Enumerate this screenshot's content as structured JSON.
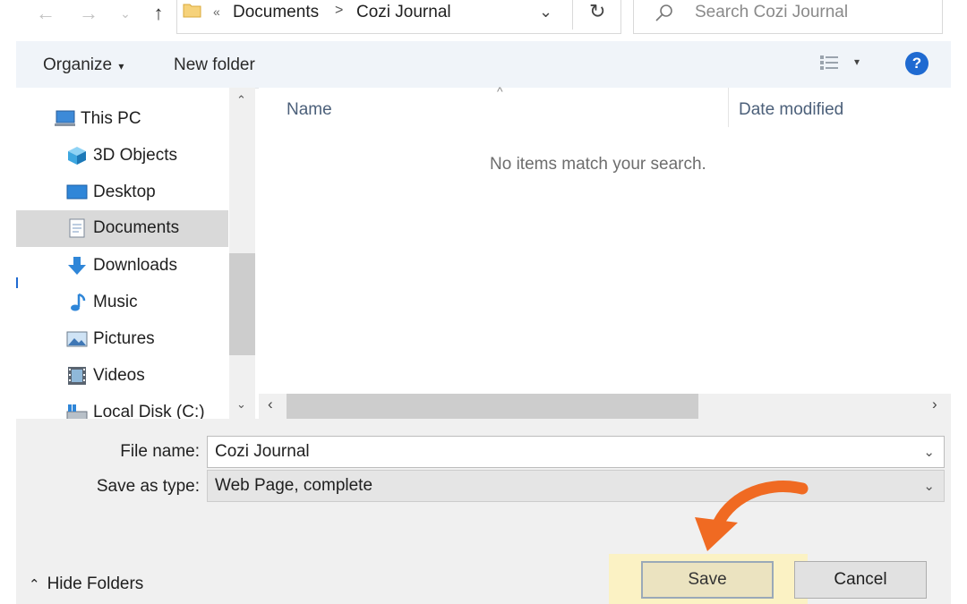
{
  "address": {
    "overflow": "«",
    "crumbs": [
      "Documents",
      "Cozi Journal"
    ],
    "separator": ">"
  },
  "search": {
    "placeholder": "Search Cozi Journal"
  },
  "toolbar": {
    "organize": "Organize",
    "organize_caret": "▾",
    "new_folder": "New folder",
    "help": "?"
  },
  "nav": {
    "items": [
      {
        "label": "This PC",
        "icon": "computer-icon"
      },
      {
        "label": "3D Objects",
        "icon": "cube-icon"
      },
      {
        "label": "Desktop",
        "icon": "desktop-icon"
      },
      {
        "label": "Documents",
        "icon": "document-icon",
        "selected": true
      },
      {
        "label": "Downloads",
        "icon": "download-arrow-icon"
      },
      {
        "label": "Music",
        "icon": "music-note-icon"
      },
      {
        "label": "Pictures",
        "icon": "picture-icon"
      },
      {
        "label": "Videos",
        "icon": "film-icon"
      },
      {
        "label": "Local Disk (C:)",
        "icon": "drive-icon"
      }
    ]
  },
  "filelist": {
    "columns": [
      "Name",
      "Date modified"
    ],
    "empty_message": "No items match your search."
  },
  "form": {
    "filename_label": "File name:",
    "filename_value": "Cozi Journal",
    "type_label": "Save as type:",
    "type_value": "Web Page, complete"
  },
  "buttons": {
    "save": "Save",
    "cancel": "Cancel",
    "hide_folders": "Hide Folders"
  },
  "colors": {
    "accent": "#1f6ad1",
    "highlight": "#fbf2c4",
    "arrow": "#f06a22"
  }
}
